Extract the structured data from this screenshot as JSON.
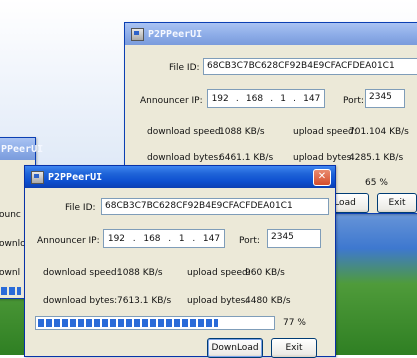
{
  "windows": {
    "back": {
      "title": "P2PPeerUI",
      "file_id_label": "File ID:",
      "file_id_value": "68CB3C7BC628CF92B4E9CFACFDEA01C1",
      "announcer_ip_label": "Announcer IP:",
      "ip": [
        "192",
        "168",
        "1",
        "147"
      ],
      "port_label": "Port:",
      "port_value": "2345",
      "download_speed_label": "download speed:",
      "download_speed_value": "1088 KB/s",
      "upload_speed_label": "upload speed:",
      "upload_speed_value": "701.104 KB/s",
      "download_bytes_label": "download bytes:",
      "download_bytes_value": "6461.1 KB/s",
      "upload_bytes_label": "upload bytes:",
      "upload_bytes_value": "4285.1 KB/s",
      "progress_percent": 65,
      "progress_text": "65 %",
      "download_button": "Load",
      "exit_button": "Exit"
    },
    "left_partial": {
      "title": "PPeerUI",
      "frag_label_1": "ounc",
      "frag_label_2": "ownlo",
      "frag_label_3": "ownl"
    },
    "front": {
      "title": "P2PPeerUI",
      "file_id_label": "File ID:",
      "file_id_value": "68CB3C7BC628CF92B4E9CFACFDEA01C1",
      "announcer_ip_label": "Announcer IP:",
      "ip": [
        "192",
        "168",
        "1",
        "147"
      ],
      "port_label": "Port:",
      "port_value": "2345",
      "download_speed_label": "download speed:",
      "download_speed_value": "1088 KB/s",
      "upload_speed_label": "upload speed:",
      "upload_speed_value": "960 KB/s",
      "download_bytes_label": "download bytes:",
      "download_bytes_value": "7613.1 KB/s",
      "upload_bytes_label": "upload bytes:",
      "upload_bytes_value": "4480 KB/s",
      "progress_percent": 77,
      "progress_text": "77 %",
      "download_button": "DownLoad",
      "exit_button": "Exit",
      "close_glyph": "✕"
    }
  }
}
